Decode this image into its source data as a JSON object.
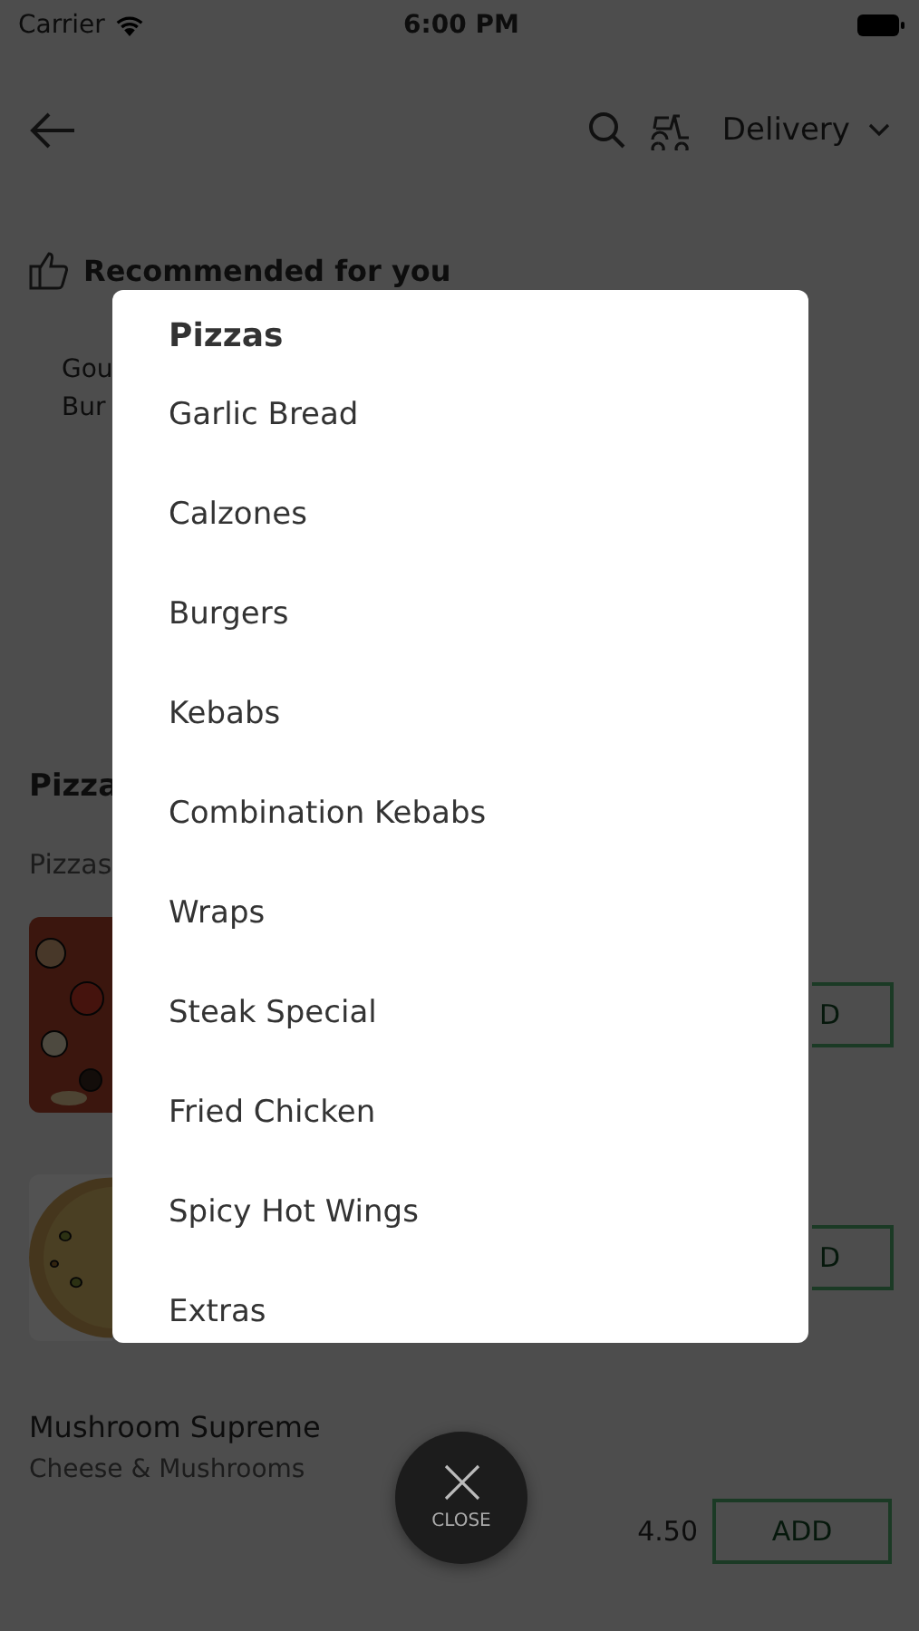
{
  "status_bar": {
    "carrier": "Carrier",
    "time": "6:00 PM"
  },
  "header": {
    "delivery_mode": "Delivery"
  },
  "recommended": {
    "title": "Recommended for you",
    "card_lines": [
      "Gou",
      "Bur"
    ]
  },
  "section": {
    "title": "Pizza",
    "subtitle": "Pizzas",
    "items": [
      {
        "kind": "picture",
        "add": "D"
      },
      {
        "kind": "picture",
        "add": "D"
      },
      {
        "kind": "text",
        "name": "Mushroom Supreme",
        "description": "Cheese & Mushrooms",
        "price": "4.50",
        "add": "ADD"
      }
    ]
  },
  "category_menu": {
    "title": "Pizzas",
    "items": [
      "Garlic Bread",
      "Calzones",
      "Burgers",
      "Kebabs",
      "Combination Kebabs",
      "Wraps",
      "Steak Special",
      "Fried Chicken",
      "Spicy Hot Wings",
      "Extras"
    ]
  },
  "close_button": {
    "label": "CLOSE"
  }
}
